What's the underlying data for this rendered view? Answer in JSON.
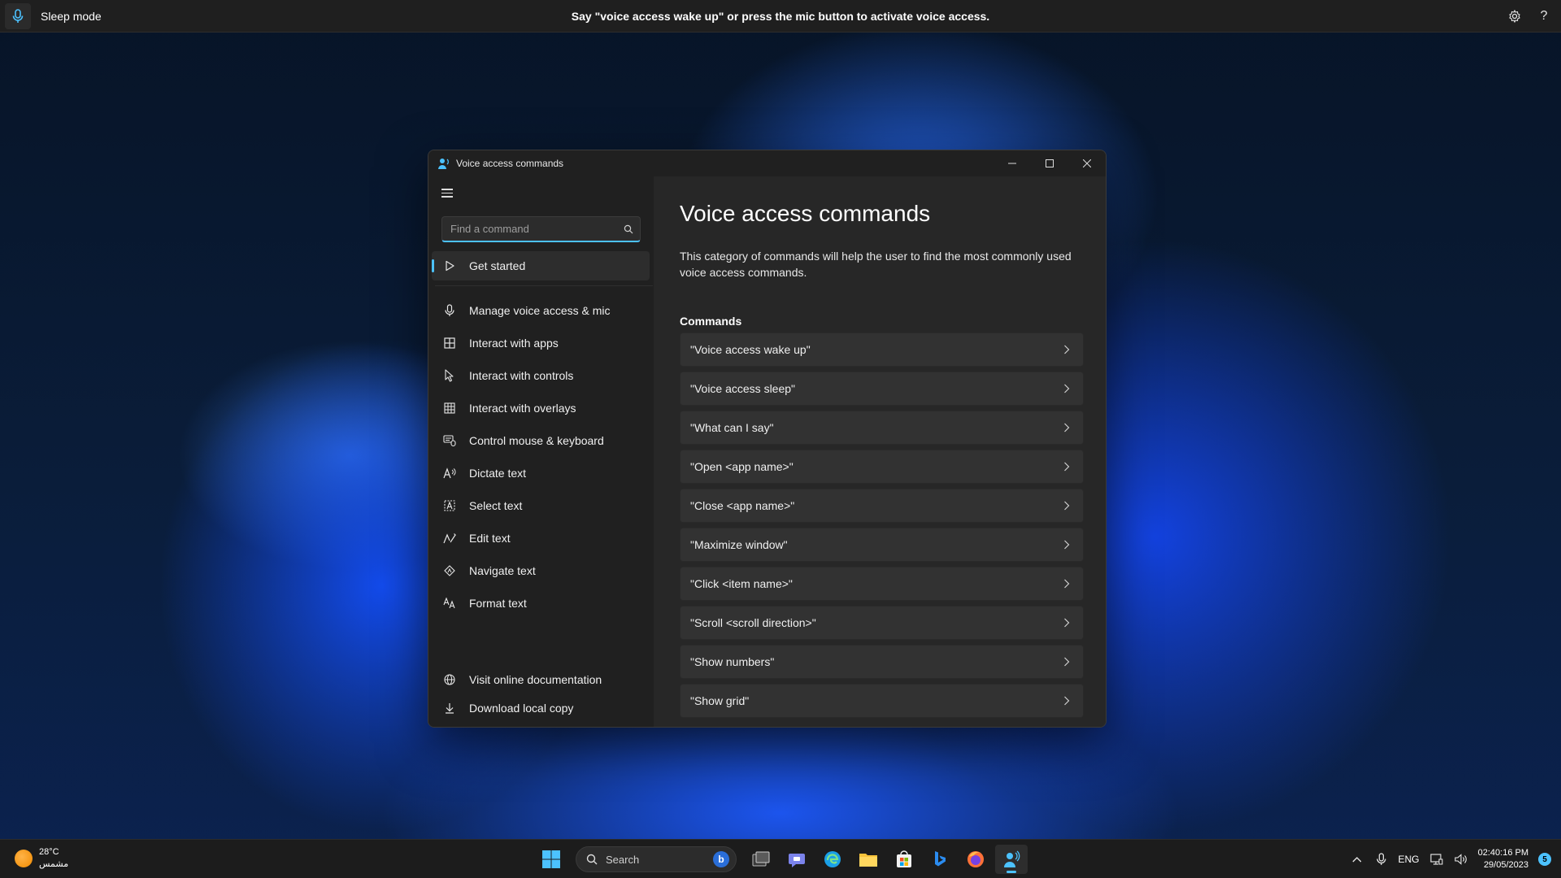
{
  "voice_access_bar": {
    "mode": "Sleep mode",
    "hint": "Say \"voice access wake up\" or press the mic button to activate voice access."
  },
  "window": {
    "title": "Voice access commands",
    "search_placeholder": "Find a command",
    "nav": [
      {
        "label": "Get started",
        "icon": "play-icon",
        "active": true
      },
      {
        "label": "Manage voice access & mic",
        "icon": "mic-icon"
      },
      {
        "label": "Interact with apps",
        "icon": "apps-icon"
      },
      {
        "label": "Interact with controls",
        "icon": "cursor-icon"
      },
      {
        "label": "Interact with overlays",
        "icon": "grid-icon"
      },
      {
        "label": "Control mouse & keyboard",
        "icon": "mouse-keyboard-icon"
      },
      {
        "label": "Dictate text",
        "icon": "dictate-icon"
      },
      {
        "label": "Select text",
        "icon": "select-text-icon"
      },
      {
        "label": "Edit text",
        "icon": "edit-text-icon"
      },
      {
        "label": "Navigate text",
        "icon": "navigate-text-icon"
      },
      {
        "label": "Format text",
        "icon": "format-text-icon"
      }
    ],
    "footer_nav": [
      {
        "label": "Visit online documentation",
        "icon": "globe-icon"
      },
      {
        "label": "Download local copy",
        "icon": "download-icon"
      }
    ],
    "content": {
      "heading": "Voice access commands",
      "description": "This category of commands will help the user to find the most commonly used voice access commands.",
      "section_label": "Commands",
      "commands": [
        "\"Voice access wake up\"",
        "\"Voice access sleep\"",
        "\"What can I say\"",
        "\"Open <app name>\"",
        "\"Close <app name>\"",
        "\"Maximize window\"",
        "\"Click <item name>\"",
        "\"Scroll <scroll direction>\"",
        "\"Show numbers\"",
        "\"Show grid\""
      ]
    }
  },
  "taskbar": {
    "weather_temp": "28°C",
    "weather_desc": "مشمس",
    "search_label": "Search",
    "language": "ENG",
    "time": "02:40:16 PM",
    "date": "29/05/2023",
    "notification_count": "5"
  },
  "colors": {
    "accent": "#4cc2ff",
    "window_bg": "#202020",
    "content_bg": "#272727",
    "command_bg": "#323232"
  }
}
